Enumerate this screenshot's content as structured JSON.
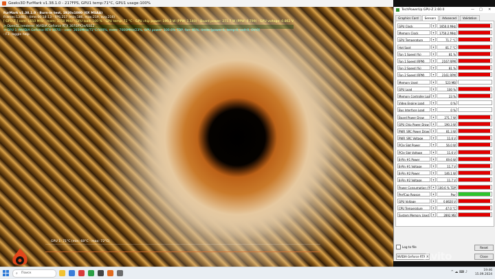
{
  "furmark": {
    "title": "Geeks3D FurMark v1.38.1.0 - 217FPS, GPU1 temp:71°C, GPU1 usage:100%",
    "overlay": {
      "line1": "FurMark v1.38.1.0 - Burn-in test, 1920x1080 (0X MSAA)",
      "line2": "Frames:13481 - time:00:18:13 - FPS:217 (min:186, max:219, avg:216)",
      "line3": "[ GPU-Z ] core: 1650 MHz - mem: 1750 MHz - GPU load: 100 % - GPU temp: 71 °C - GPU chip power: 190.3 W (PPW: 1.140) - Board power: 271.7 W (PPW: 0.799) - GPU voltage: 0.862 V",
      "line4": "> OpenGL renderer: NVIDIA GeForce RTX 3070/PCIe/SSE2",
      "line5": "> GPU 1 (NVIDIA GeForce RTX 3070) - core: 1650MHz/71°C/100%, mem: 7000MHz/23%, GPU power: 100.6% TDP, fan: 81%, limits:[power:1, temp:0, volt:0, OV:0]",
      "line6": "- F1: toggle help"
    },
    "graph_label": "GPU 1: 71°C (min: 68°C - max: 72°C)"
  },
  "gpuz": {
    "title": "TechPowerUp GPU-Z 2.60.0",
    "controls": [
      "—",
      "□",
      "✕"
    ],
    "tabs": [
      {
        "label": "Graphics Card",
        "active": false
      },
      {
        "label": "Sensors",
        "active": true
      },
      {
        "label": "Advanced",
        "active": false
      },
      {
        "label": "Validation",
        "active": false
      }
    ],
    "sensors": [
      {
        "label": "GPU Clock",
        "value": "1650.0 MHz",
        "fill": 0.95
      },
      {
        "label": "Memory Clock",
        "value": "1750.2 MHz",
        "fill": 0.95
      },
      {
        "label": "GPU Temperature",
        "value": "71.7 °C",
        "fill": 0.95
      },
      {
        "label": "Hot Spot",
        "value": "81.7 °C",
        "fill": 0.95
      },
      {
        "label": "Fan 1 Speed (%)",
        "value": "81 %",
        "fill": 0.95
      },
      {
        "label": "Fan 1 Speed (RPM)",
        "value": "2167 RPM",
        "fill": 0.95
      },
      {
        "label": "Fan 2 Speed (%)",
        "value": "81 %",
        "fill": 0.95
      },
      {
        "label": "Fan 2 Speed (RPM)",
        "value": "2161 RPM",
        "fill": 0.95
      },
      {
        "label": "Memory Used",
        "value": "523 MB",
        "fill": 0.0
      },
      {
        "label": "GPU Load",
        "value": "100 %",
        "fill": 0.95
      },
      {
        "label": "Memory Controller Load",
        "value": "23 %",
        "fill": 0.95
      },
      {
        "label": "Video Engine Load",
        "value": "0 %",
        "fill": 0.0
      },
      {
        "label": "Bus Interface Load",
        "value": "0 %",
        "fill": 0.0
      },
      {
        "label": "Board Power Draw",
        "value": "271.7 W",
        "fill": 0.95
      },
      {
        "label": "GPU Chip Power Draw",
        "value": "190.3 W",
        "fill": 0.95
      },
      {
        "label": "PWR_SRC Power Draw",
        "value": "81.3 W",
        "fill": 0.95
      },
      {
        "label": "PWR_SRC Voltage",
        "value": "11.6 V",
        "fill": 0.95
      },
      {
        "label": "PCIe Slot Power",
        "value": "56.0 W",
        "fill": 0.95
      },
      {
        "label": "PCIe Slot Voltage",
        "value": "11.6 V",
        "fill": 0.95
      },
      {
        "label": "8-Pin #1 Power",
        "value": "69.6 W",
        "fill": 0.95
      },
      {
        "label": "8-Pin #1 Voltage",
        "value": "11.7 V",
        "fill": 0.95
      },
      {
        "label": "8-Pin #2 Power",
        "value": "146.1 W",
        "fill": 0.95
      },
      {
        "label": "8-Pin #2 Voltage",
        "value": "11.7 V",
        "fill": 0.95
      },
      {
        "label": "Power Consumption (%)",
        "value": "100.6 % TDP",
        "fill": 0.95
      },
      {
        "label": "PerfCap Reason",
        "value": "Pwr",
        "fill": 0.95,
        "color": "green"
      },
      {
        "label": "GPU Voltage",
        "value": "0.8620 V",
        "fill": 0.95
      },
      {
        "label": "CPU Temperature",
        "value": "47.0 °C",
        "fill": 0.95
      },
      {
        "label": "System Memory Used",
        "value": "2892 MB",
        "fill": 0.95
      }
    ],
    "log_to_file": "Log to file",
    "reset": "Reset",
    "close": "Close",
    "device": "NVIDIA GeForce RTX 3070"
  },
  "taskbar": {
    "search_placeholder": "Поиск",
    "time": "19:46",
    "date": "15.09.2024"
  },
  "watermark": "Avito"
}
